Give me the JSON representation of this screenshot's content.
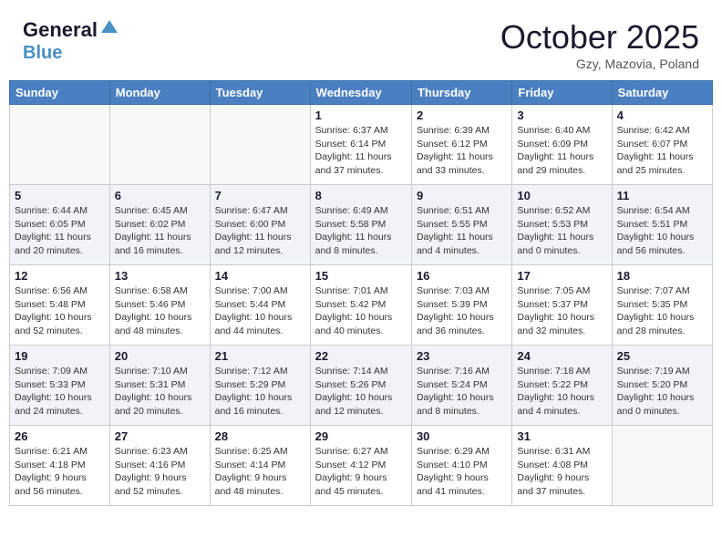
{
  "header": {
    "logo_line1": "General",
    "logo_line2": "Blue",
    "month": "October 2025",
    "location": "Gzy, Mazovia, Poland"
  },
  "weekdays": [
    "Sunday",
    "Monday",
    "Tuesday",
    "Wednesday",
    "Thursday",
    "Friday",
    "Saturday"
  ],
  "weeks": [
    [
      {
        "day": "",
        "info": ""
      },
      {
        "day": "",
        "info": ""
      },
      {
        "day": "",
        "info": ""
      },
      {
        "day": "1",
        "info": "Sunrise: 6:37 AM\nSunset: 6:14 PM\nDaylight: 11 hours\nand 37 minutes."
      },
      {
        "day": "2",
        "info": "Sunrise: 6:39 AM\nSunset: 6:12 PM\nDaylight: 11 hours\nand 33 minutes."
      },
      {
        "day": "3",
        "info": "Sunrise: 6:40 AM\nSunset: 6:09 PM\nDaylight: 11 hours\nand 29 minutes."
      },
      {
        "day": "4",
        "info": "Sunrise: 6:42 AM\nSunset: 6:07 PM\nDaylight: 11 hours\nand 25 minutes."
      }
    ],
    [
      {
        "day": "5",
        "info": "Sunrise: 6:44 AM\nSunset: 6:05 PM\nDaylight: 11 hours\nand 20 minutes."
      },
      {
        "day": "6",
        "info": "Sunrise: 6:45 AM\nSunset: 6:02 PM\nDaylight: 11 hours\nand 16 minutes."
      },
      {
        "day": "7",
        "info": "Sunrise: 6:47 AM\nSunset: 6:00 PM\nDaylight: 11 hours\nand 12 minutes."
      },
      {
        "day": "8",
        "info": "Sunrise: 6:49 AM\nSunset: 5:58 PM\nDaylight: 11 hours\nand 8 minutes."
      },
      {
        "day": "9",
        "info": "Sunrise: 6:51 AM\nSunset: 5:55 PM\nDaylight: 11 hours\nand 4 minutes."
      },
      {
        "day": "10",
        "info": "Sunrise: 6:52 AM\nSunset: 5:53 PM\nDaylight: 11 hours\nand 0 minutes."
      },
      {
        "day": "11",
        "info": "Sunrise: 6:54 AM\nSunset: 5:51 PM\nDaylight: 10 hours\nand 56 minutes."
      }
    ],
    [
      {
        "day": "12",
        "info": "Sunrise: 6:56 AM\nSunset: 5:48 PM\nDaylight: 10 hours\nand 52 minutes."
      },
      {
        "day": "13",
        "info": "Sunrise: 6:58 AM\nSunset: 5:46 PM\nDaylight: 10 hours\nand 48 minutes."
      },
      {
        "day": "14",
        "info": "Sunrise: 7:00 AM\nSunset: 5:44 PM\nDaylight: 10 hours\nand 44 minutes."
      },
      {
        "day": "15",
        "info": "Sunrise: 7:01 AM\nSunset: 5:42 PM\nDaylight: 10 hours\nand 40 minutes."
      },
      {
        "day": "16",
        "info": "Sunrise: 7:03 AM\nSunset: 5:39 PM\nDaylight: 10 hours\nand 36 minutes."
      },
      {
        "day": "17",
        "info": "Sunrise: 7:05 AM\nSunset: 5:37 PM\nDaylight: 10 hours\nand 32 minutes."
      },
      {
        "day": "18",
        "info": "Sunrise: 7:07 AM\nSunset: 5:35 PM\nDaylight: 10 hours\nand 28 minutes."
      }
    ],
    [
      {
        "day": "19",
        "info": "Sunrise: 7:09 AM\nSunset: 5:33 PM\nDaylight: 10 hours\nand 24 minutes."
      },
      {
        "day": "20",
        "info": "Sunrise: 7:10 AM\nSunset: 5:31 PM\nDaylight: 10 hours\nand 20 minutes."
      },
      {
        "day": "21",
        "info": "Sunrise: 7:12 AM\nSunset: 5:29 PM\nDaylight: 10 hours\nand 16 minutes."
      },
      {
        "day": "22",
        "info": "Sunrise: 7:14 AM\nSunset: 5:26 PM\nDaylight: 10 hours\nand 12 minutes."
      },
      {
        "day": "23",
        "info": "Sunrise: 7:16 AM\nSunset: 5:24 PM\nDaylight: 10 hours\nand 8 minutes."
      },
      {
        "day": "24",
        "info": "Sunrise: 7:18 AM\nSunset: 5:22 PM\nDaylight: 10 hours\nand 4 minutes."
      },
      {
        "day": "25",
        "info": "Sunrise: 7:19 AM\nSunset: 5:20 PM\nDaylight: 10 hours\nand 0 minutes."
      }
    ],
    [
      {
        "day": "26",
        "info": "Sunrise: 6:21 AM\nSunset: 4:18 PM\nDaylight: 9 hours\nand 56 minutes."
      },
      {
        "day": "27",
        "info": "Sunrise: 6:23 AM\nSunset: 4:16 PM\nDaylight: 9 hours\nand 52 minutes."
      },
      {
        "day": "28",
        "info": "Sunrise: 6:25 AM\nSunset: 4:14 PM\nDaylight: 9 hours\nand 48 minutes."
      },
      {
        "day": "29",
        "info": "Sunrise: 6:27 AM\nSunset: 4:12 PM\nDaylight: 9 hours\nand 45 minutes."
      },
      {
        "day": "30",
        "info": "Sunrise: 6:29 AM\nSunset: 4:10 PM\nDaylight: 9 hours\nand 41 minutes."
      },
      {
        "day": "31",
        "info": "Sunrise: 6:31 AM\nSunset: 4:08 PM\nDaylight: 9 hours\nand 37 minutes."
      },
      {
        "day": "",
        "info": ""
      }
    ]
  ]
}
